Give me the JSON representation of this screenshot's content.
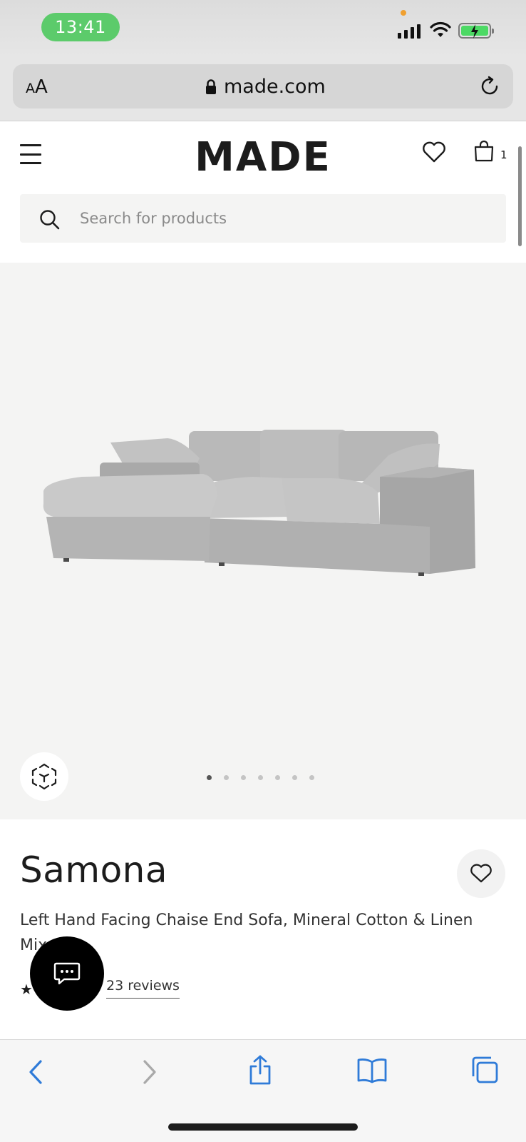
{
  "status_bar": {
    "time": "13:41"
  },
  "browser": {
    "text_size_label_small": "A",
    "text_size_label_large": "A",
    "url": "made.com"
  },
  "header": {
    "logo": "MADE",
    "bag_count": "1"
  },
  "search": {
    "placeholder": "Search for products",
    "value": ""
  },
  "gallery": {
    "slide_count": 7,
    "active_slide": 1
  },
  "product": {
    "title": "Samona",
    "description": "Left Hand Facing Chaise End Sofa, Mineral Cotton & Linen Mix",
    "rating_star": "★",
    "reviews_label": "23 reviews"
  },
  "colors": {
    "brand": "#1c1c1c",
    "time_pill": "#5ccb6b",
    "battery": "#4cd964",
    "ios_blue": "#2f7bd8",
    "gallery_bg": "#f4f4f3"
  },
  "icons": [
    "hamburger-icon",
    "heart-icon",
    "bag-icon",
    "search-icon",
    "ar-cube-icon",
    "chat-icon",
    "back-icon",
    "forward-icon",
    "share-icon",
    "bookmarks-icon",
    "tabs-icon",
    "lock-icon",
    "reload-icon"
  ]
}
